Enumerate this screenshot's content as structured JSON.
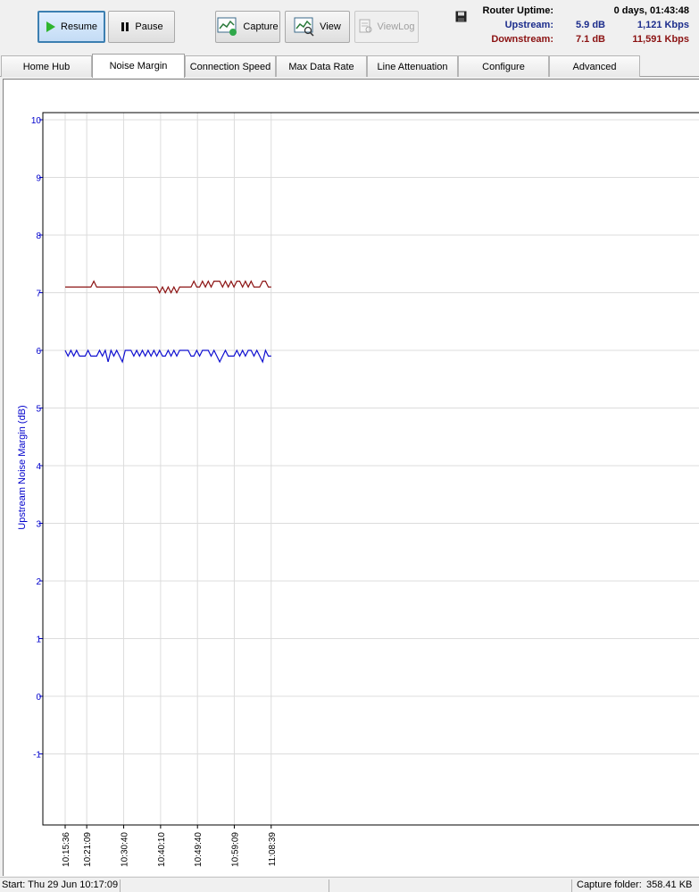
{
  "toolbar": {
    "resume_label": "Resume",
    "pause_label": "Pause",
    "capture_label": "Capture",
    "view_label": "View",
    "viewlog_label": "ViewLog"
  },
  "stats": {
    "uptime_label": "Router Uptime:",
    "uptime_value": "0 days, 01:43:48",
    "upstream_label": "Upstream:",
    "upstream_margin": "5.9 dB",
    "upstream_rate": "1,121 Kbps",
    "downstream_label": "Downstream:",
    "downstream_margin": "7.1 dB",
    "downstream_rate": "11,591 Kbps"
  },
  "tabs": [
    {
      "label": "Home Hub",
      "selected": false
    },
    {
      "label": "Noise Margin",
      "selected": true
    },
    {
      "label": "Connection Speed",
      "selected": false
    },
    {
      "label": "Max Data Rate",
      "selected": false
    },
    {
      "label": "Line Attenuation",
      "selected": false
    },
    {
      "label": "Configure",
      "selected": false
    },
    {
      "label": "Advanced",
      "selected": false
    }
  ],
  "status": {
    "start": "Start: Thu 29 Jun 10:17:09",
    "capture_folder_label": "Capture folder:",
    "capture_folder_size": "358.41 KB"
  },
  "colors": {
    "upstream": "#1010d0",
    "downstream": "#8b1212",
    "ylabel": "#0000cc",
    "grid": "#dcdcdc"
  },
  "chart_data": {
    "type": "line",
    "ylabel": "Upstream Noise Margin (dB)",
    "ylim": [
      -2,
      10
    ],
    "y_ticks": [
      10,
      9,
      8,
      7,
      6,
      5,
      4,
      3,
      2,
      1,
      0,
      -1
    ],
    "x_tick_labels": [
      "10:15:36",
      "10:21:09",
      "10:30:40",
      "10:40:10",
      "10:49:40",
      "10:59:09",
      "11:08:39"
    ],
    "x_tick_minutes": [
      0,
      5.55,
      15.07,
      24.57,
      34.07,
      43.55,
      53.05
    ],
    "x_span_minutes": [
      -7,
      140
    ],
    "grid": true,
    "series": [
      {
        "key": "downstream",
        "t_start": 0,
        "t_end": 53.05,
        "values": [
          7.1,
          7.1,
          7.1,
          7.1,
          7.1,
          7.1,
          7.1,
          7.1,
          7.1,
          7.1,
          7.2,
          7.1,
          7.1,
          7.1,
          7.1,
          7.1,
          7.1,
          7.1,
          7.1,
          7.1,
          7.1,
          7.1,
          7.1,
          7.1,
          7.1,
          7.1,
          7.1,
          7.1,
          7.1,
          7.1,
          7.1,
          7.1,
          7.1,
          7.0,
          7.1,
          7.0,
          7.1,
          7.0,
          7.1,
          7.0,
          7.1,
          7.1,
          7.1,
          7.1,
          7.1,
          7.2,
          7.1,
          7.1,
          7.2,
          7.1,
          7.2,
          7.1,
          7.2,
          7.2,
          7.2,
          7.1,
          7.2,
          7.1,
          7.2,
          7.1,
          7.2,
          7.2,
          7.1,
          7.2,
          7.1,
          7.2,
          7.1,
          7.1,
          7.1,
          7.2,
          7.2,
          7.1,
          7.1
        ]
      },
      {
        "key": "upstream",
        "t_start": 0,
        "t_end": 53.05,
        "values": [
          6.0,
          5.9,
          6.0,
          5.9,
          6.0,
          5.9,
          5.9,
          5.9,
          6.0,
          5.9,
          5.9,
          5.9,
          6.0,
          5.9,
          6.0,
          5.8,
          6.0,
          5.9,
          6.0,
          5.9,
          5.8,
          6.0,
          6.0,
          6.0,
          5.9,
          6.0,
          5.9,
          6.0,
          5.9,
          6.0,
          5.9,
          6.0,
          5.9,
          6.0,
          5.9,
          5.9,
          6.0,
          5.9,
          6.0,
          5.9,
          6.0,
          6.0,
          6.0,
          6.0,
          5.9,
          5.9,
          6.0,
          5.9,
          6.0,
          6.0,
          6.0,
          5.9,
          6.0,
          5.9,
          5.8,
          5.9,
          6.0,
          5.9,
          5.9,
          5.9,
          6.0,
          5.9,
          6.0,
          5.9,
          6.0,
          6.0,
          5.9,
          6.0,
          5.9,
          5.8,
          6.0,
          5.9,
          5.9
        ]
      }
    ]
  }
}
